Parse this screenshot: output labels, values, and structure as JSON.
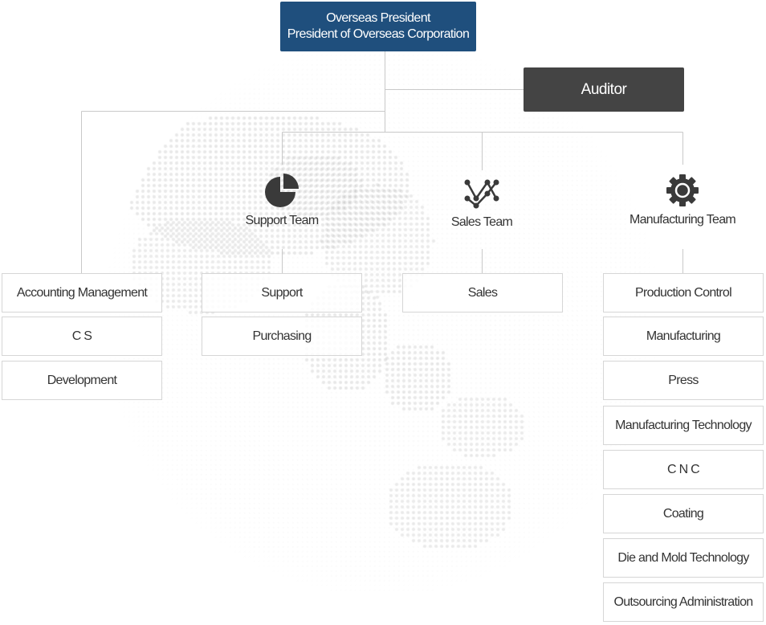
{
  "president": {
    "line1": "Overseas President",
    "line2": "President of Overseas Corporation"
  },
  "auditor": "Auditor",
  "teams": [
    {
      "label": "Support Team",
      "icon": "pie-chart-icon"
    },
    {
      "label": "Sales Team",
      "icon": "network-chart-icon"
    },
    {
      "label": "Manufacturing Team",
      "icon": "gear-icon"
    }
  ],
  "departments": {
    "direct": [
      "Accounting Management",
      "C S",
      "Development"
    ],
    "support": [
      "Support",
      "Purchasing"
    ],
    "sales": [
      "Sales"
    ],
    "manufacturing": [
      "Production Control",
      "Manufacturing",
      "Press",
      "Manufacturing Technology",
      "C N C",
      "Coating",
      "Die and Mold Technology",
      "Outsourcing Administration"
    ]
  },
  "colors": {
    "president": "#1f4f7d",
    "auditor": "#444444",
    "line": "#c9c9c9",
    "box_border": "#d6d6d6",
    "icon": "#3a3a3a"
  }
}
